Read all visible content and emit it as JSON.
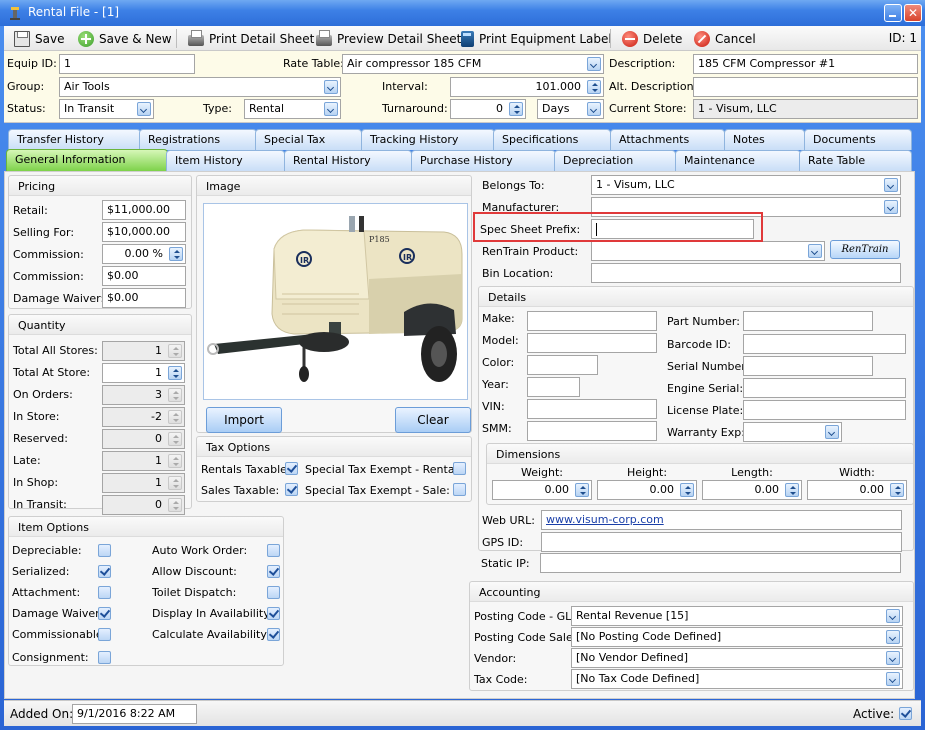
{
  "window": {
    "title": "Rental File - [1]",
    "close_glyph": "✕"
  },
  "toolbar": {
    "save": "Save",
    "save_new": "Save & New",
    "print_detail": "Print Detail Sheet",
    "preview_detail": "Preview Detail Sheet",
    "print_label": "Print Equipment Label",
    "delete": "Delete",
    "cancel": "Cancel",
    "id_label": "ID: 1"
  },
  "header": {
    "equip_id_label": "Equip ID:",
    "equip_id": "1",
    "rate_table_label": "Rate Table:",
    "rate_table": "Air compressor 185 CFM",
    "description_label": "Description:",
    "description": "185 CFM Compressor #1",
    "group_label": "Group:",
    "group": "Air Tools",
    "interval_label": "Interval:",
    "interval": "101.000",
    "alt_description_label": "Alt. Description:",
    "alt_description": "",
    "status_label": "Status:",
    "status": "In Transit",
    "type_label": "Type:",
    "type": "Rental",
    "turnaround_label": "Turnaround:",
    "turnaround": "0",
    "turnaround_unit": "Days",
    "current_store_label": "Current Store:",
    "current_store": "1 - Visum, LLC"
  },
  "tabs": {
    "row1": [
      "Transfer History",
      "Registrations",
      "Special Tax",
      "Tracking History",
      "Specifications",
      "Attachments",
      "Notes",
      "Documents"
    ],
    "row2": [
      "General Information",
      "Item History",
      "Rental History",
      "Purchase History",
      "Depreciation",
      "Maintenance",
      "Rate Table"
    ],
    "active": "General Information"
  },
  "pricing": {
    "title": "Pricing",
    "retail_label": "Retail:",
    "retail": "$11,000.00",
    "selling_label": "Selling For:",
    "selling": "$10,000.00",
    "commission_pct_label": "Commission:",
    "commission_pct": "0.00 %",
    "commission_label": "Commission:",
    "commission": "$0.00",
    "damage_waiver_label": "Damage Waiver:",
    "damage_waiver": "$0.00"
  },
  "quantity": {
    "title": "Quantity",
    "rows": [
      {
        "label": "Total All Stores:",
        "value": "1",
        "editable": false
      },
      {
        "label": "Total At Store:",
        "value": "1",
        "editable": true
      },
      {
        "label": "On Orders:",
        "value": "3",
        "editable": false
      },
      {
        "label": "In Store:",
        "value": "-2",
        "editable": false
      },
      {
        "label": "Reserved:",
        "value": "0",
        "editable": false
      },
      {
        "label": "Late:",
        "value": "1",
        "editable": false
      },
      {
        "label": "In Shop:",
        "value": "1",
        "editable": false
      },
      {
        "label": "In Transit:",
        "value": "0",
        "editable": false
      }
    ]
  },
  "image": {
    "title": "Image",
    "alt": "Ingersoll Rand P185 portable air compressor",
    "model_text": "P185",
    "brand_text": "IR",
    "import": "Import",
    "clear": "Clear"
  },
  "tax_options": {
    "title": "Tax Options",
    "rentals_taxable_label": "Rentals Taxable:",
    "rentals_taxable": true,
    "sales_taxable_label": "Sales Taxable:",
    "sales_taxable": true,
    "exempt_rentals_label": "Special Tax Exempt - Rentals:",
    "exempt_rentals": false,
    "exempt_sale_label": "Special Tax Exempt - Sale:",
    "exempt_sale": false
  },
  "item_options": {
    "title": "Item Options",
    "left": [
      {
        "label": "Depreciable:",
        "checked": false
      },
      {
        "label": "Serialized:",
        "checked": true
      },
      {
        "label": "Attachment:",
        "checked": false
      },
      {
        "label": "Damage Waiver:",
        "checked": true
      },
      {
        "label": "Commissionable:",
        "checked": false
      },
      {
        "label": "Consignment:",
        "checked": false
      }
    ],
    "right": [
      {
        "label": "Auto Work Order:",
        "checked": false
      },
      {
        "label": "Allow Discount:",
        "checked": true
      },
      {
        "label": "Toilet Dispatch:",
        "checked": false
      },
      {
        "label": "Display In Availability:",
        "checked": true
      },
      {
        "label": "Calculate Availability:",
        "checked": true
      }
    ]
  },
  "right_panel": {
    "belongs_to_label": "Belongs To:",
    "belongs_to": "1 - Visum, LLC",
    "manufacturer_label": "Manufacturer:",
    "manufacturer": "",
    "spec_prefix_label": "Spec Sheet Prefix:",
    "spec_prefix": "",
    "rentrain_label": "RenTrain Product:",
    "rentrain": "",
    "rentrain_button": "RenTrain",
    "bin_label": "Bin Location:",
    "bin": ""
  },
  "details": {
    "title": "Details",
    "left": [
      {
        "label": "Make:",
        "value": ""
      },
      {
        "label": "Model:",
        "value": ""
      },
      {
        "label": "Color:",
        "value": ""
      },
      {
        "label": "Year:",
        "value": ""
      },
      {
        "label": "VIN:",
        "value": ""
      },
      {
        "label": "SMM:",
        "value": ""
      }
    ],
    "right": [
      {
        "label": "Part Number:",
        "value": ""
      },
      {
        "label": "Barcode ID:",
        "value": ""
      },
      {
        "label": "Serial Number:",
        "value": ""
      },
      {
        "label": "Engine Serial:",
        "value": ""
      },
      {
        "label": "License Plate:",
        "value": ""
      },
      {
        "label": "Warranty Exp:",
        "value": ""
      }
    ]
  },
  "dimensions": {
    "title": "Dimensions",
    "items": [
      {
        "label": "Weight:",
        "value": "0.00"
      },
      {
        "label": "Height:",
        "value": "0.00"
      },
      {
        "label": "Length:",
        "value": "0.00"
      },
      {
        "label": "Width:",
        "value": "0.00"
      }
    ]
  },
  "web": {
    "url_label": "Web URL:",
    "url": "www.visum-corp.com",
    "gps_label": "GPS ID:",
    "gps": "",
    "ip_label": "Static IP:",
    "ip": ""
  },
  "accounting": {
    "title": "Accounting",
    "rows": [
      {
        "label": "Posting Code - GL:",
        "value": "Rental Revenue [15]"
      },
      {
        "label": "Posting Code Sale:",
        "value": "[No Posting Code Defined]"
      },
      {
        "label": "Vendor:",
        "value": "[No Vendor Defined]"
      },
      {
        "label": "Tax Code:",
        "value": "[No Tax Code Defined]"
      }
    ]
  },
  "status_bar": {
    "added_on_label": "Added On:",
    "added_on": "9/1/2016 8:22 AM",
    "active_label": "Active:",
    "active": true
  }
}
